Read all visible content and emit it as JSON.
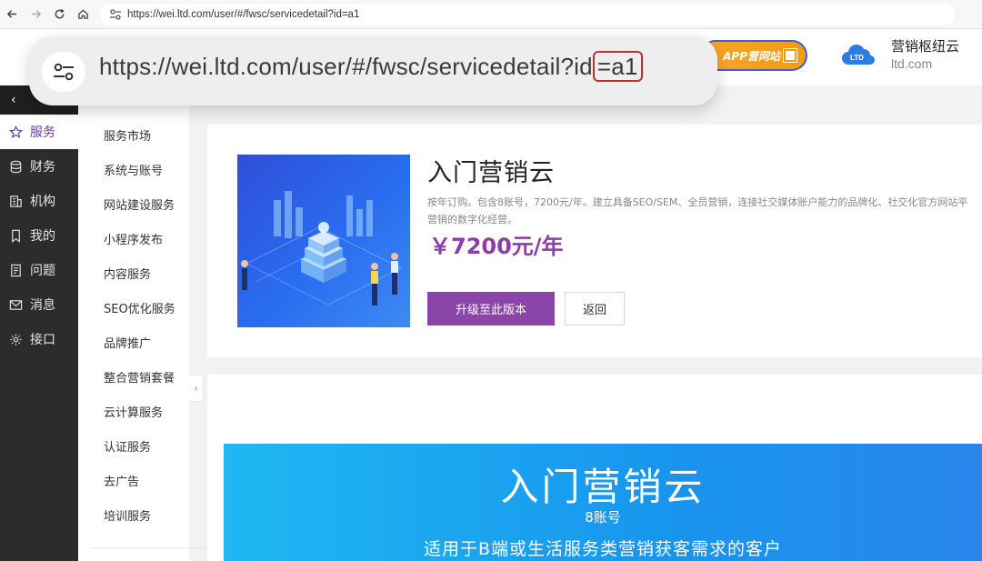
{
  "browser": {
    "url": "https://wei.ltd.com/user/#/fwsc/servicedetail?id=a1"
  },
  "url_popup": {
    "url_main": "https://wei.ltd.com/user/#/fwsc/servicedetail?id",
    "url_highlight": "=a1",
    "highlight_color": "#c0302a"
  },
  "header": {
    "app_badge": "APP营网站",
    "brand_name": "营销枢纽云",
    "brand_domain": "ltd.com"
  },
  "sidebar": {
    "items": [
      {
        "label": "服务",
        "icon": "star-icon",
        "active": true
      },
      {
        "label": "财务",
        "icon": "database-icon"
      },
      {
        "label": "机构",
        "icon": "building-icon"
      },
      {
        "label": "我的",
        "icon": "bookmark-icon"
      },
      {
        "label": "问题",
        "icon": "document-icon"
      },
      {
        "label": "消息",
        "icon": "mail-icon"
      },
      {
        "label": "接口",
        "icon": "gear-icon"
      }
    ]
  },
  "submenu": {
    "items": [
      "服务市场",
      "系统与账号",
      "网站建设服务",
      "小程序发布",
      "内容服务",
      "SEO优化服务",
      "品牌推广",
      "整合营销套餐",
      "云计算服务",
      "认证服务",
      "去广告",
      "培训服务"
    ]
  },
  "product": {
    "title": "入门营销云",
    "desc_line1": "按年订购。包含8账号，7200元/年。建立具备SEO/SEM、全员营销，连接社交媒体账户能力的品牌化、社交化官方网站平",
    "desc_line2": "营销的数字化经营。",
    "price": "￥7200元/年",
    "upgrade_label": "升级至此版本",
    "back_label": "返回"
  },
  "banner": {
    "title": "入门营销云",
    "subtitle": "8账号",
    "description": "适用于B端或生活服务类营销获客需求的客户"
  },
  "colors": {
    "accent": "#8b44a8",
    "sidebar_bg": "#2c2c2c",
    "banner": "#1fa6f1"
  }
}
